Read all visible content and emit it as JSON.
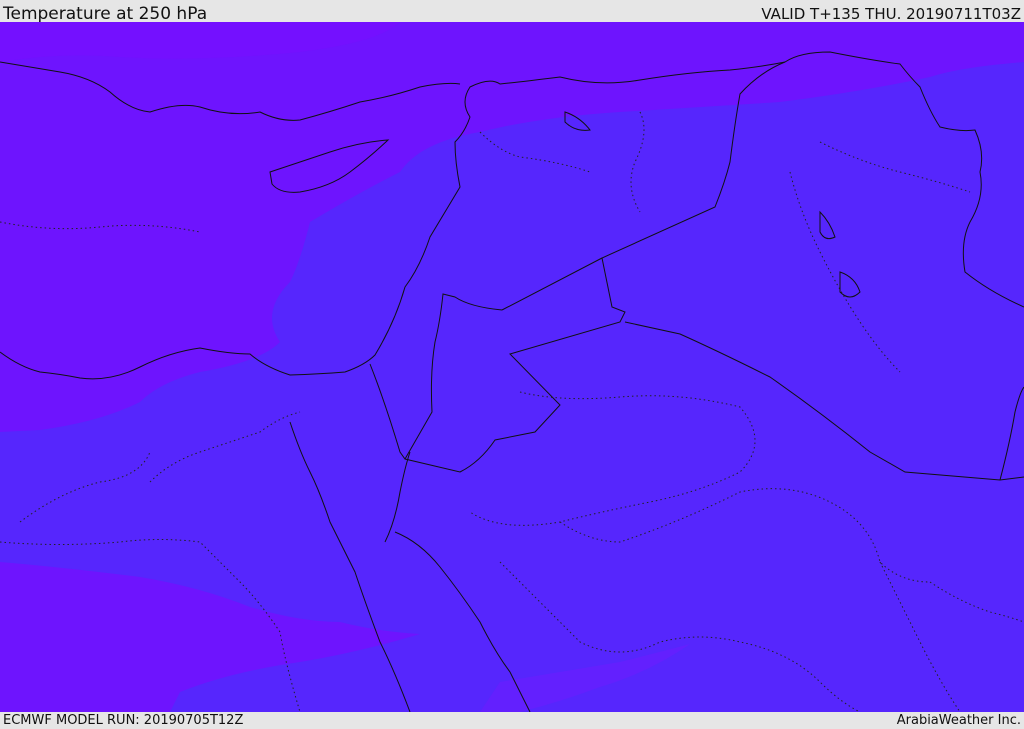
{
  "header": {
    "title": "Temperature at 250 hPa",
    "valid": "VALID T+135 THU. 20190711T03Z"
  },
  "footer": {
    "model_run": "ECMWF MODEL RUN: 20190705T12Z",
    "credit": "ArabiaWeather Inc."
  },
  "map": {
    "field": "temperature",
    "level": "250 hPa",
    "colors": {
      "cold_band": "#6e14fe",
      "warm_band": "#5626fd",
      "transition_band": "#6320fe",
      "coastline": "#111111",
      "border": "#111111"
    }
  }
}
